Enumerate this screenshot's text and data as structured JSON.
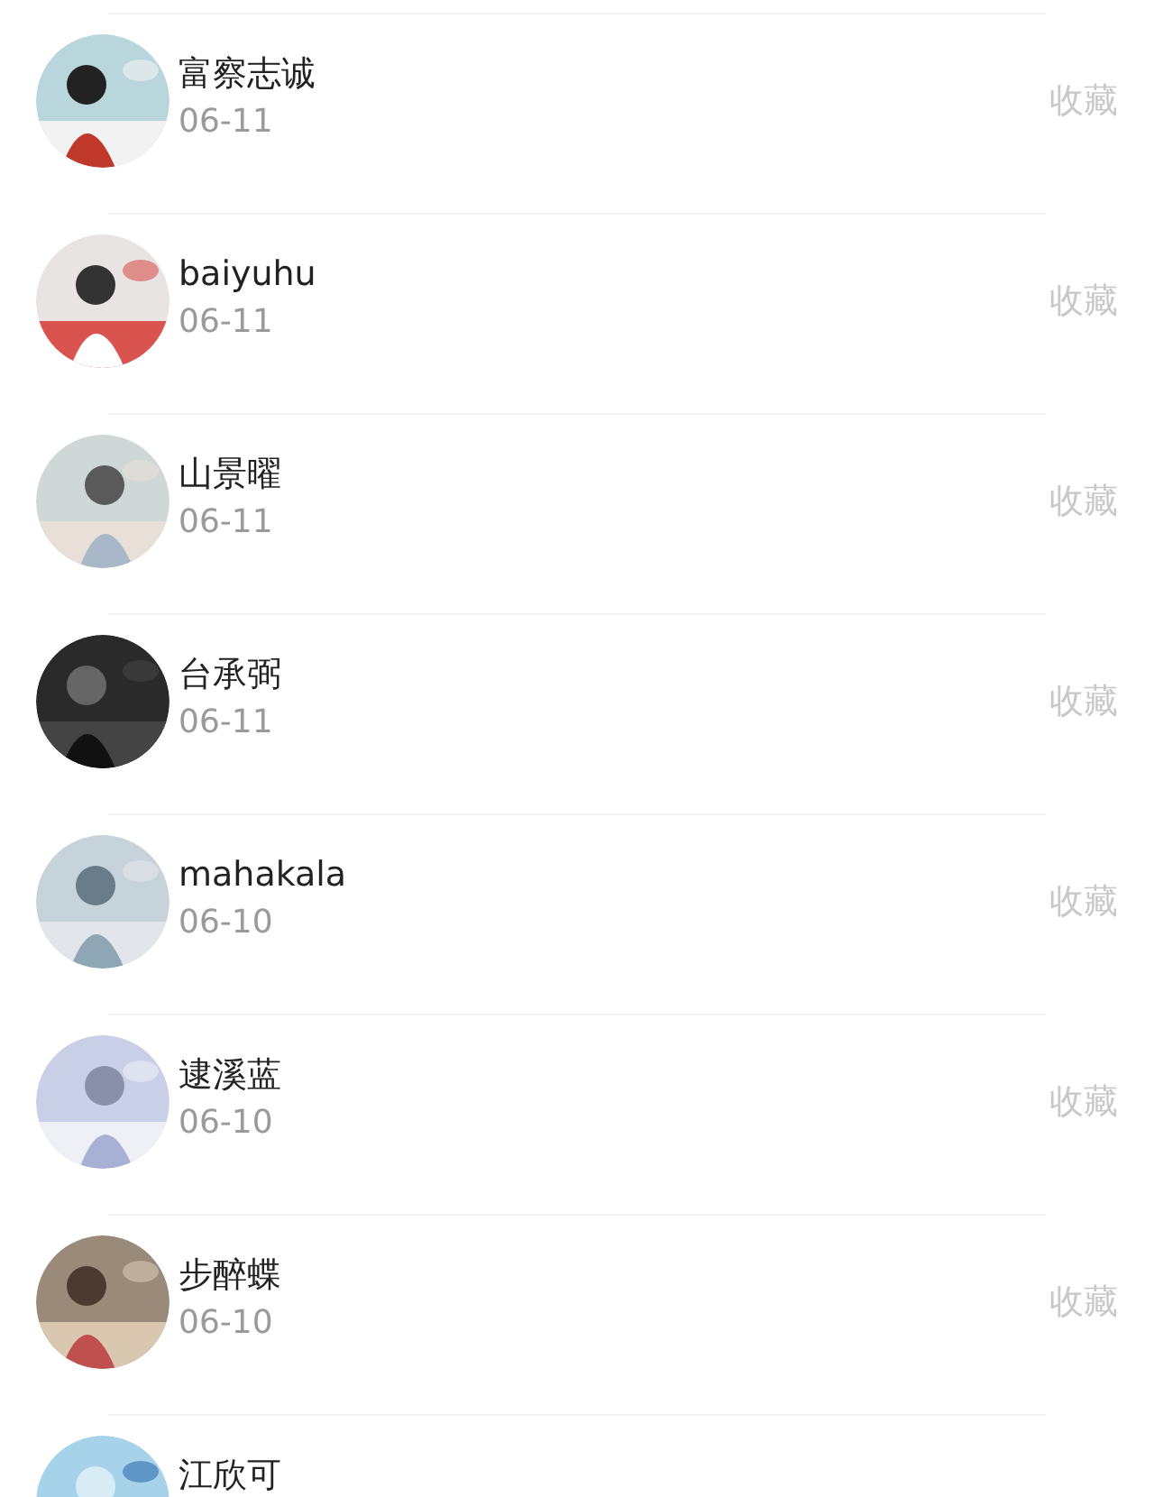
{
  "items": [
    {
      "name": "富察志诚",
      "date": "06-11",
      "action": "收藏"
    },
    {
      "name": "baiyuhu",
      "date": "06-11",
      "action": "收藏"
    },
    {
      "name": "山景曜",
      "date": "06-11",
      "action": "收藏"
    },
    {
      "name": "台承弼",
      "date": "06-11",
      "action": "收藏"
    },
    {
      "name": "mahakala",
      "date": "06-10",
      "action": "收藏"
    },
    {
      "name": "逮溪蓝",
      "date": "06-10",
      "action": "收藏"
    },
    {
      "name": "步醉蝶",
      "date": "06-10",
      "action": "收藏"
    },
    {
      "name": "江欣可"
    }
  ]
}
